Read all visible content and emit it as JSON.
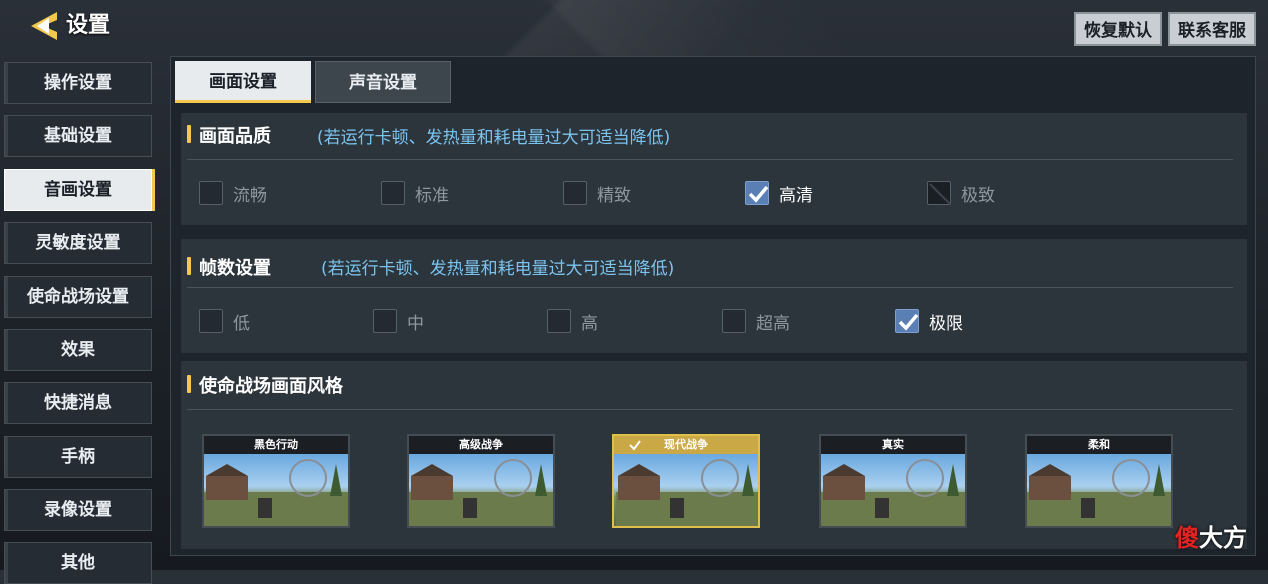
{
  "header": {
    "title": "设置",
    "reset_label": "恢复默认",
    "support_label": "联系客服"
  },
  "menu": [
    {
      "label": "操作设置",
      "active": false
    },
    {
      "label": "基础设置",
      "active": false
    },
    {
      "label": "音画设置",
      "active": true
    },
    {
      "label": "灵敏度设置",
      "active": false
    },
    {
      "label": "使命战场设置",
      "active": false
    },
    {
      "label": "效果",
      "active": false
    },
    {
      "label": "快捷消息",
      "active": false
    },
    {
      "label": "手柄",
      "active": false
    },
    {
      "label": "录像设置",
      "active": false
    },
    {
      "label": "其他",
      "active": false
    }
  ],
  "tabs": [
    {
      "label": "画面设置",
      "active": true
    },
    {
      "label": "声音设置",
      "active": false
    }
  ],
  "quality": {
    "title": "画面品质",
    "note": "(若运行卡顿、发热量和耗电量过大可适当降低)",
    "options": [
      {
        "label": "流畅",
        "checked": false
      },
      {
        "label": "标准",
        "checked": false
      },
      {
        "label": "精致",
        "checked": false
      },
      {
        "label": "高清",
        "checked": true
      },
      {
        "label": "极致",
        "checked": false
      }
    ]
  },
  "framerate": {
    "title": "帧数设置",
    "note": "(若运行卡顿、发热量和耗电量过大可适当降低)",
    "options": [
      {
        "label": "低",
        "checked": false
      },
      {
        "label": "中",
        "checked": false
      },
      {
        "label": "高",
        "checked": false
      },
      {
        "label": "超高",
        "checked": false
      },
      {
        "label": "极限",
        "checked": true
      }
    ]
  },
  "style": {
    "title": "使命战场画面风格",
    "cards": [
      {
        "label": "黑色行动",
        "selected": false
      },
      {
        "label": "高级战争",
        "selected": false
      },
      {
        "label": "现代战争",
        "selected": true
      },
      {
        "label": "真实",
        "selected": false
      },
      {
        "label": "柔和",
        "selected": false
      }
    ]
  },
  "watermark": {
    "part1": "傻",
    "part2": "大方"
  },
  "colors": {
    "accent": "#f2c94c",
    "note": "#7cc4ee",
    "check": "#5a7fb4"
  }
}
